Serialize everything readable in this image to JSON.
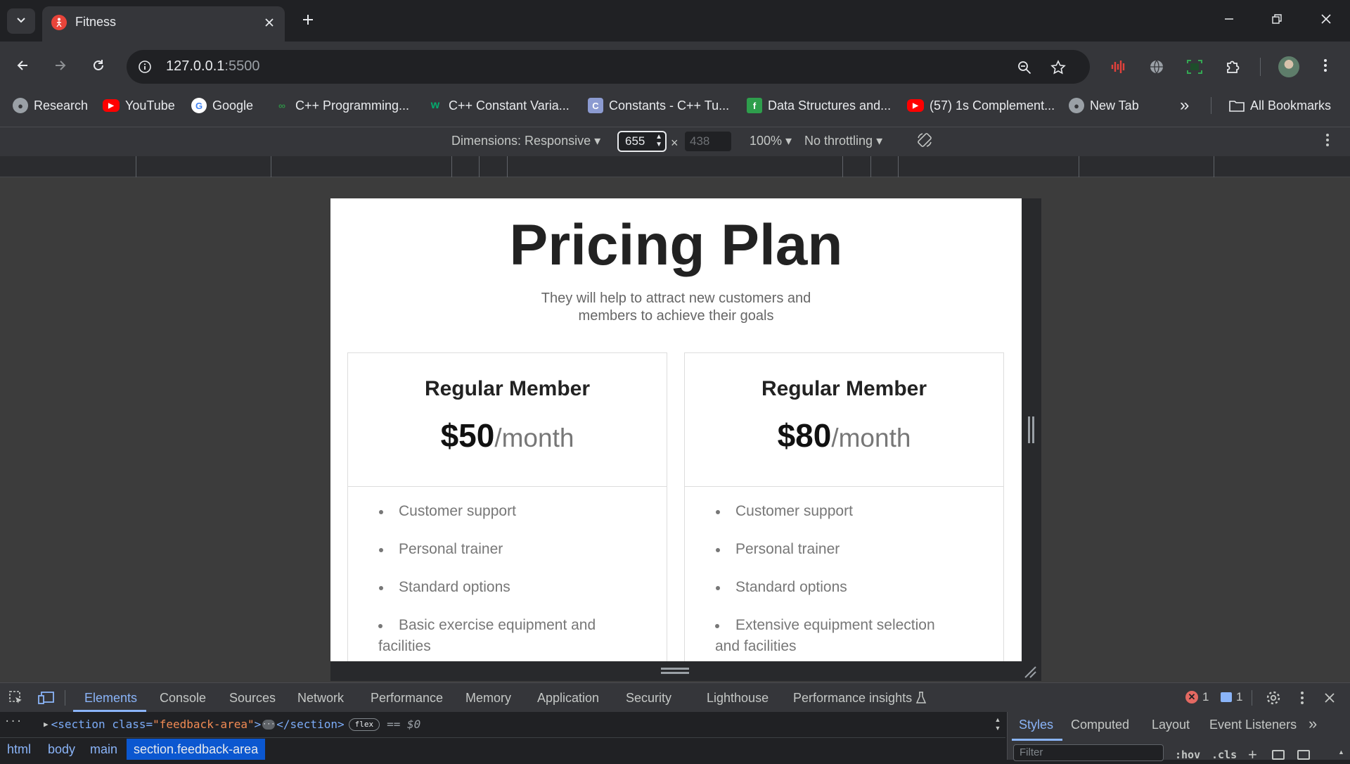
{
  "browser": {
    "tab_title": "Fitness",
    "address": {
      "host": "127.0.0.1",
      "port": ":5500"
    },
    "bookmarks": [
      {
        "label": "Research",
        "icon": "globe-icon"
      },
      {
        "label": "YouTube",
        "icon": "youtube-icon"
      },
      {
        "label": "Google",
        "icon": "google-icon"
      },
      {
        "label": "C++ Programming...",
        "icon": "gfg-icon"
      },
      {
        "label": "C++ Constant Varia...",
        "icon": "w3-icon"
      },
      {
        "label": "Constants - C++ Tu...",
        "icon": "cplusplus-icon"
      },
      {
        "label": "Data Structures and...",
        "icon": "book-icon"
      },
      {
        "label": "(57) 1s Complement...",
        "icon": "youtube-icon"
      },
      {
        "label": "New Tab",
        "icon": "globe-icon"
      }
    ],
    "all_bookmarks": "All Bookmarks",
    "overflow": "»"
  },
  "device_toolbar": {
    "dimensions_label": "Dimensions: Responsive",
    "width": "655",
    "height_placeholder": "438",
    "times": "×",
    "zoom": "100%",
    "throttling": "No throttling"
  },
  "page": {
    "title": "Pricing Plan",
    "subtitle_line1": "They will help to attract new customers and",
    "subtitle_line2": "members to achieve their goals",
    "plans": [
      {
        "name": "Regular Member",
        "price": "$50",
        "period": "/month",
        "features": [
          "Customer support",
          "Personal trainer",
          "Standard options",
          "Basic exercise equipment and facilities"
        ]
      },
      {
        "name": "Regular Member",
        "price": "$80",
        "period": "/month",
        "features": [
          "Customer support",
          "Personal trainer",
          "Standard options",
          "Extensive equipment selection and facilities"
        ]
      }
    ]
  },
  "devtools": {
    "tabs": [
      "Elements",
      "Console",
      "Sources",
      "Network",
      "Performance",
      "Memory",
      "Application",
      "Security",
      "Lighthouse",
      "Performance insights"
    ],
    "errors": "1",
    "messages": "1",
    "dom_line": {
      "open": "<section class=",
      "cls": "\"feedback-area\"",
      "close": "</section>",
      "badge": "flex",
      "eq": "== $0"
    },
    "breadcrumbs": [
      "html",
      "body",
      "main",
      "section.feedback-area"
    ],
    "side_tabs": [
      "Styles",
      "Computed",
      "Layout",
      "Event Listeners"
    ],
    "filter_placeholder": "Filter",
    "hov": ":hov",
    "cls": ".cls"
  },
  "colors": {
    "accent": "#8ab4f8",
    "tab_bg": "#35363a",
    "frame": "#202124"
  }
}
